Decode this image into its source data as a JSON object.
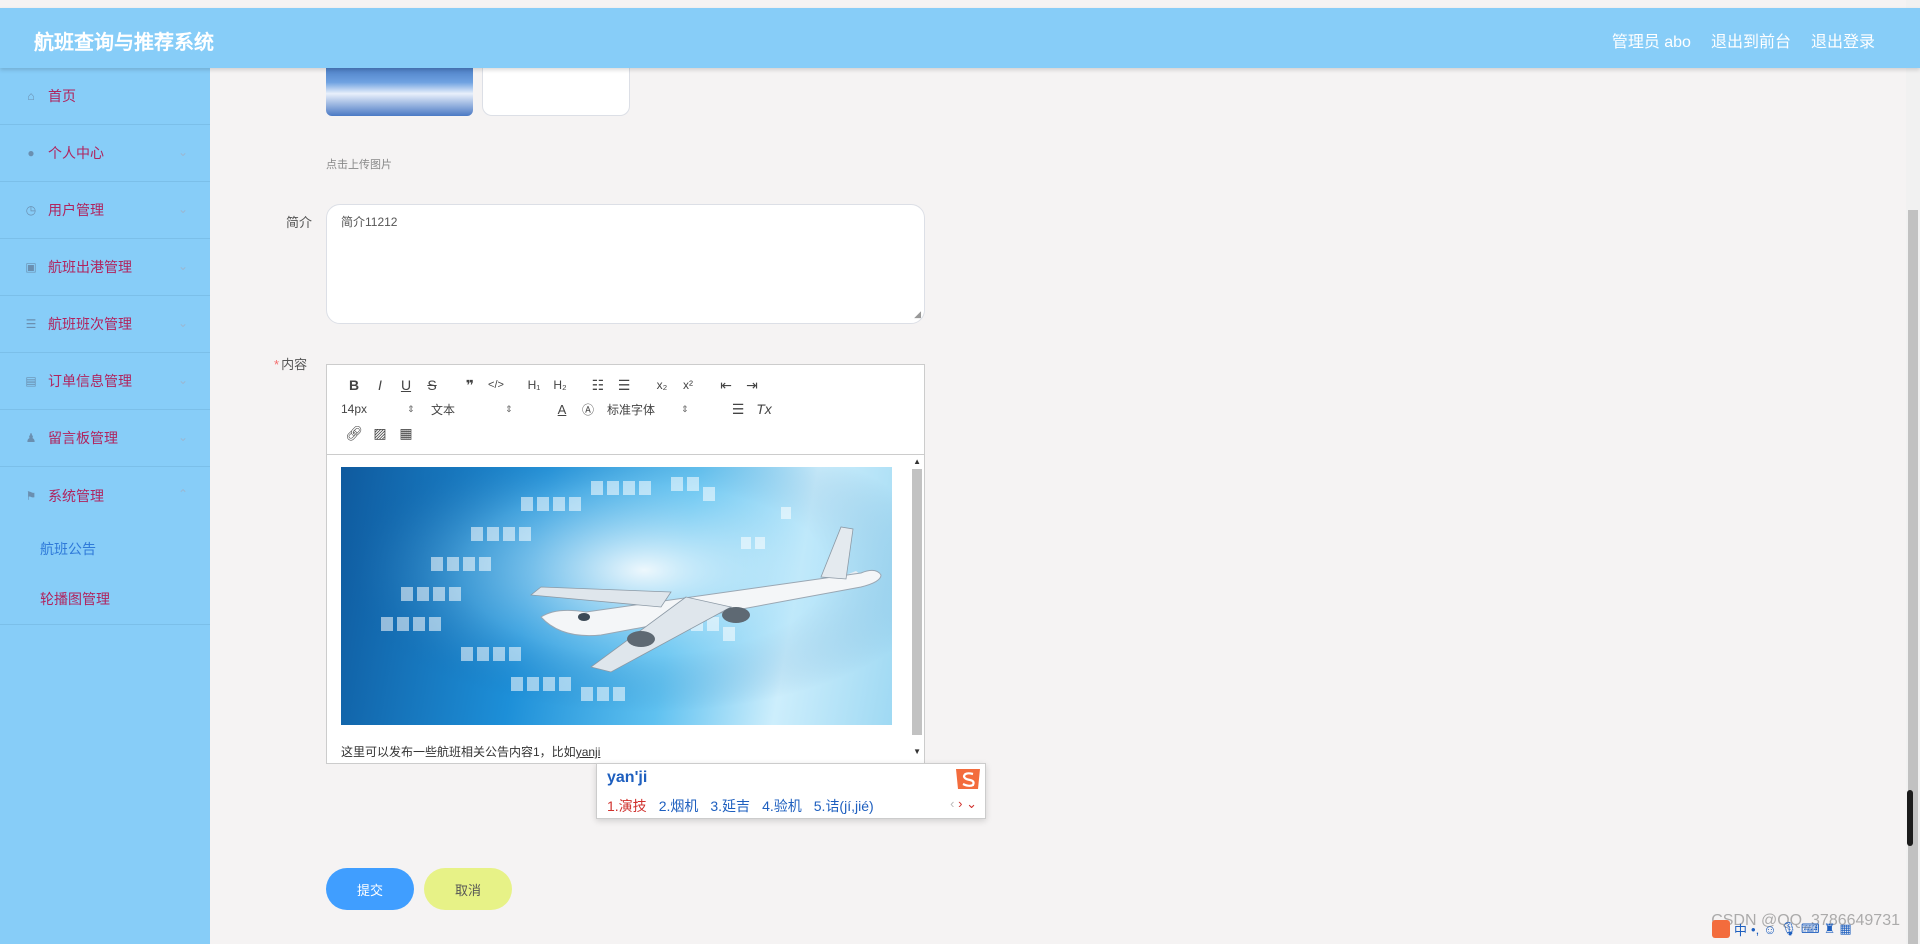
{
  "header": {
    "title": "航班查询与推荐系统",
    "links": [
      "管理员 abo",
      "退出到前台",
      "退出登录"
    ]
  },
  "sidebar": {
    "items": [
      {
        "label": "首页",
        "icon": "home-icon",
        "has_children": false
      },
      {
        "label": "个人中心",
        "icon": "user-icon",
        "has_children": true
      },
      {
        "label": "用户管理",
        "icon": "clock-icon",
        "has_children": true
      },
      {
        "label": "航班出港管理",
        "icon": "clipboard-icon",
        "has_children": true
      },
      {
        "label": "航班班次管理",
        "icon": "list-icon",
        "has_children": true
      },
      {
        "label": "订单信息管理",
        "icon": "clipboard-check-icon",
        "has_children": true
      },
      {
        "label": "留言板管理",
        "icon": "person-icon",
        "has_children": true
      },
      {
        "label": "系统管理",
        "icon": "flag-icon",
        "has_children": true,
        "expanded": true
      }
    ],
    "sub_items": [
      "航班公告",
      "轮播图管理"
    ],
    "active_sub_item": "航班公告"
  },
  "form": {
    "upload_hint": "点击上传图片",
    "intro_label": "简介",
    "intro_value": "简介11212",
    "content_label": "内容",
    "content_required_mark": "*",
    "content_text": "这里可以发布一些航班相关公告内容1，比如",
    "content_typing": "yanji",
    "toolbar": {
      "font_size": "14px",
      "block_type": "文本",
      "font_family": "标准字体"
    },
    "submit_label": "提交",
    "cancel_label": "取消"
  },
  "ime": {
    "input": "yan'ji",
    "candidates": [
      "1.演技",
      "2.烟机",
      "3.延吉",
      "4.验机",
      "5.诘(jí,jié)"
    ]
  },
  "watermark": "CSDN @QQ_3786649731",
  "taskbar": {
    "ime_mode": "中"
  },
  "colors": {
    "header_bg": "#87cdf8",
    "sidebar_bg": "#87cdf8",
    "menu_text": "#b0245e",
    "active_sub": "#2f7ad9",
    "submit_bg": "#409eff",
    "cancel_bg": "#e7f287"
  }
}
